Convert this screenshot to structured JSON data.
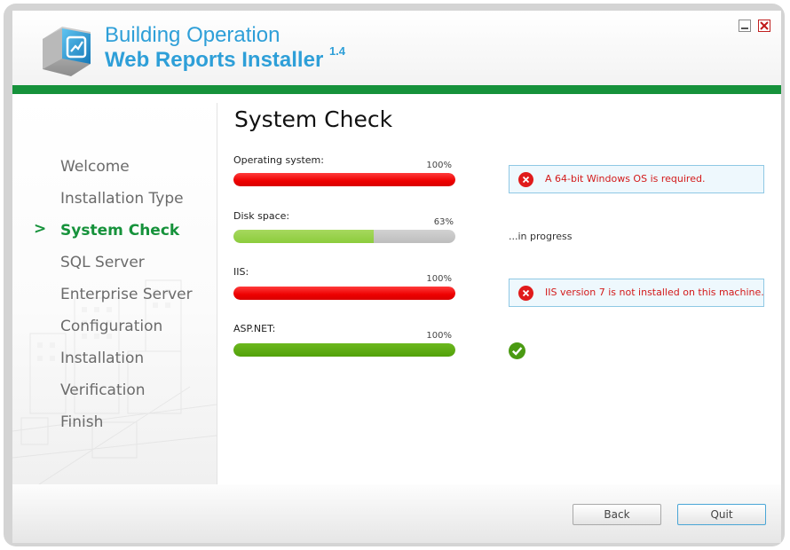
{
  "window": {
    "title_line1": "Building Operation",
    "title_line2": "Web Reports Installer",
    "version": "1.4",
    "controls": {
      "minimize_icon": "minimize-icon",
      "close_icon": "close-icon"
    }
  },
  "colors": {
    "accent_blue": "#2e9fd8",
    "brand_green": "#16923b",
    "error_red": "#ee0000",
    "progress_lime": "#8ccc3c",
    "success_green": "#52a10a"
  },
  "sidebar": {
    "active_marker": ">",
    "items": [
      {
        "label": "Welcome",
        "active": false
      },
      {
        "label": "Installation Type",
        "active": false
      },
      {
        "label": "System Check",
        "active": true
      },
      {
        "label": "SQL Server",
        "active": false
      },
      {
        "label": "Enterprise Server",
        "active": false
      },
      {
        "label": "Configuration",
        "active": false
      },
      {
        "label": "Installation",
        "active": false
      },
      {
        "label": "Verification",
        "active": false
      },
      {
        "label": "Finish",
        "active": false
      }
    ]
  },
  "main": {
    "title": "System Check",
    "checks": [
      {
        "label": "Operating system:",
        "percent_text": "100%",
        "progress": 1.0,
        "status": "error",
        "message": "A 64-bit Windows OS is required."
      },
      {
        "label": "Disk space:",
        "percent_text": "63%",
        "progress": 0.63,
        "status": "in-progress",
        "message": "...in progress"
      },
      {
        "label": "IIS:",
        "percent_text": "100%",
        "progress": 1.0,
        "status": "error",
        "message": "IIS version 7 is not installed on this machine."
      },
      {
        "label": "ASP.NET:",
        "percent_text": "100%",
        "progress": 1.0,
        "status": "ok",
        "message": ""
      }
    ]
  },
  "footer": {
    "back_label": "Back",
    "quit_label": "Quit"
  }
}
